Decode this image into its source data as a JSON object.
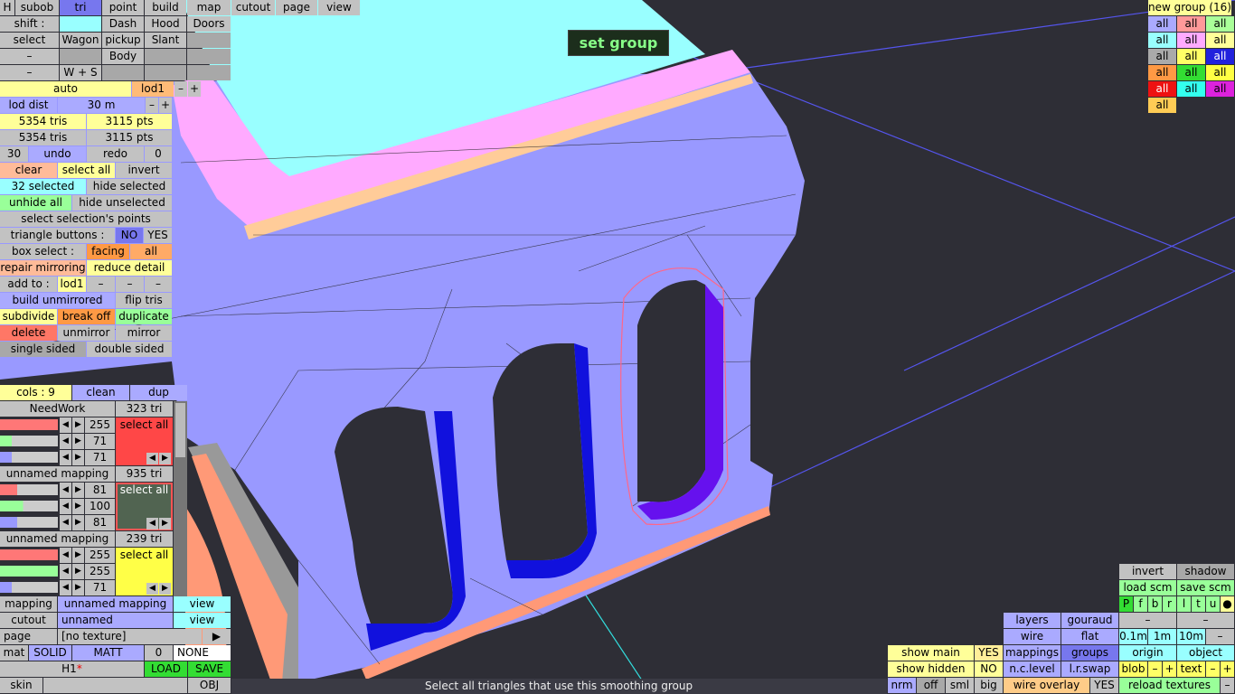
{
  "toolbar": {
    "r1": [
      "H",
      "subob",
      "tri",
      "point",
      "build",
      "map",
      "cutout",
      "page",
      "view"
    ],
    "r2": [
      "shift :",
      "",
      "Dash",
      "Hood",
      "Doors"
    ],
    "r3": [
      "select",
      "Wagon",
      "pickup",
      "Slant"
    ],
    "r4": [
      "–",
      "",
      "Body"
    ],
    "r5": [
      "–",
      "W + S"
    ]
  },
  "left": {
    "auto": "auto",
    "lod1": "lod1",
    "minus": "–",
    "plus": "+",
    "lod_dist": "lod dist",
    "dist_val": "30 m",
    "tris1": "5354 tris",
    "pts1": "3115 pts",
    "tris2": "5354 tris",
    "pts2": "3115 pts",
    "n30": "30",
    "undo": "undo",
    "redo": "redo",
    "zero": "0",
    "clear": "clear",
    "select_all": "select all",
    "invert": "invert",
    "selected": "32 selected",
    "hide_selected": "hide selected",
    "unhide_all": "unhide all",
    "hide_unselected": "hide unselected",
    "select_points": "select selection's points",
    "tri_buttons": "triangle buttons :",
    "no": "NO",
    "yes": "YES",
    "box_select": "box select :",
    "facing": "facing",
    "all": "all",
    "repair": "repair mirroring",
    "reduce": "reduce detail",
    "add_to": "add to :",
    "add_lod": "lod1",
    "build_unmirrored": "build unmirrored",
    "flip_tris": "flip tris",
    "subdivide": "subdivide",
    "break_off": "break off",
    "duplicate": "duplicate",
    "delete": "delete",
    "unmirror": "unmirror",
    "mirror": "mirror",
    "single_sided": "single sided",
    "double_sided": "double sided"
  },
  "materials": {
    "cols": "cols : 9",
    "clean": "clean",
    "dup": "dup",
    "items": [
      {
        "name": "NeedWork",
        "tri": "323 tri",
        "r": "255",
        "g": "71",
        "b": "71",
        "sel": "select all",
        "color": "#ff4747"
      },
      {
        "name": "unnamed mapping",
        "tri": "935 tri",
        "r": "81",
        "g": "100",
        "b": "81",
        "sel": "select all",
        "color": "#516451"
      },
      {
        "name": "unnamed mapping",
        "tri": "239 tri",
        "r": "255",
        "g": "255",
        "b": "71",
        "sel": "select all",
        "color": "#ffff47"
      }
    ]
  },
  "bottom_left": {
    "mapping": "mapping",
    "mapping_val": "unnamed mapping",
    "view": "view",
    "cutout": "cutout",
    "cutout_val": "unnamed",
    "view2": "view",
    "page": "page",
    "page_val": "[no texture]",
    "play": "▶",
    "mat": "mat",
    "solid": "SOLID",
    "matt": "MATT",
    "mat_zero": "0",
    "none": "NONE",
    "h1": "H1",
    "star": "*",
    "load": "LOAD",
    "save": "SAVE",
    "skin": "skin",
    "obj": "OBJ"
  },
  "viewport": {
    "set_group": "set group",
    "tooltip": "Select all triangles that use this smoothing group"
  },
  "groups": {
    "title": "new group (16)",
    "cells": [
      {
        "label": "all",
        "bg": "#aaaaff",
        "fg": "#000"
      },
      {
        "label": "all",
        "bg": "#ff9999",
        "fg": "#000"
      },
      {
        "label": "all",
        "bg": "#aaff99",
        "fg": "#000"
      },
      {
        "label": "all",
        "bg": "#99ffff",
        "fg": "#000"
      },
      {
        "label": "all",
        "bg": "#ffaaff",
        "fg": "#000"
      },
      {
        "label": "all",
        "bg": "#ffff99",
        "fg": "#000"
      },
      {
        "label": "all",
        "bg": "#aaaaaa",
        "fg": "#000"
      },
      {
        "label": "all",
        "bg": "#ffff66",
        "fg": "#000"
      },
      {
        "label": "all",
        "bg": "#2222dd",
        "fg": "#fff"
      },
      {
        "label": "all",
        "bg": "#ff9944",
        "fg": "#000"
      },
      {
        "label": "all",
        "bg": "#33dd33",
        "fg": "#000"
      },
      {
        "label": "all",
        "bg": "#ffff44",
        "fg": "#000"
      },
      {
        "label": "all",
        "bg": "#ee1111",
        "fg": "#fff"
      },
      {
        "label": "all",
        "bg": "#33ffee",
        "fg": "#000"
      },
      {
        "label": "all",
        "bg": "#dd22dd",
        "fg": "#000"
      },
      {
        "label": "all",
        "bg": "#ffcc55",
        "fg": "#000"
      }
    ]
  },
  "right_bottom": {
    "invert": "invert",
    "shadow": "shadow",
    "load_scm": "load scm",
    "save_scm": "save scm",
    "letters": [
      "P",
      "f",
      "b",
      "r",
      "l",
      "t",
      "u",
      "●"
    ],
    "dash1": "–",
    "dash2": "–",
    "layers": "layers",
    "gouraud": "gouraud",
    "wire": "wire",
    "flat": "flat",
    "d01": "0.1m",
    "d1": "1m",
    "d10": "10m",
    "dminus": "–",
    "show_main": "show main",
    "yes": "YES",
    "mappings": "mappings",
    "groups": "groups",
    "origin": "origin",
    "object": "object",
    "show_hidden": "show hidden",
    "no": "NO",
    "nc_level": "n.c.level",
    "lr_swap": "l.r.swap",
    "blob": "blob",
    "text": "text",
    "minus": "–",
    "plus": "+",
    "nrm": "nrm",
    "off": "off",
    "sml": "sml",
    "big": "big",
    "wire_overlay": "wire overlay",
    "yes2": "YES",
    "reload": "reload textures",
    "dash3": "–"
  }
}
